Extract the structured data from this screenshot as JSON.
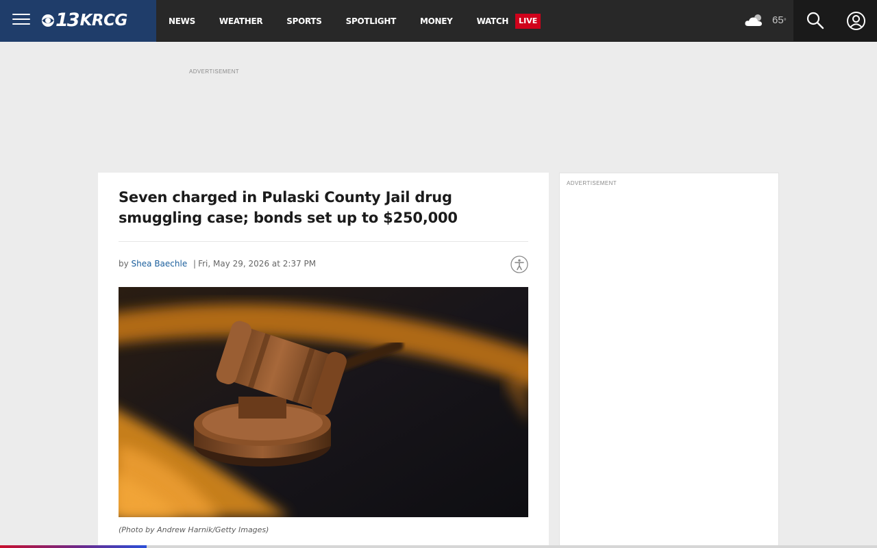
{
  "header": {
    "logo": {
      "number": "13",
      "text": "KRCG"
    },
    "nav_items": [
      {
        "label": "NEWS"
      },
      {
        "label": "WEATHER"
      },
      {
        "label": "SPORTS"
      },
      {
        "label": "SPOTLIGHT"
      },
      {
        "label": "MONEY"
      }
    ],
    "watch": {
      "label": "WATCH",
      "live_badge": "LIVE"
    },
    "weather": {
      "temperature": "65",
      "degree_symbol": "°",
      "icon": "partly-cloudy-icon"
    },
    "icons": {
      "menu": "menu-icon",
      "search": "search-icon",
      "account": "user-icon"
    }
  },
  "ads": {
    "top_label": "ADVERTISEMENT",
    "sidebar_label": "ADVERTISEMENT"
  },
  "article": {
    "headline": "Seven charged in Pulaski County Jail drug smuggling case; bonds set up to $250,000",
    "byline": {
      "prefix": "by",
      "author": "Shea Baechle",
      "separator": "|",
      "date": "Fri, May 29, 2026 at 2:37 PM"
    },
    "photo_icon": "gavel-photo",
    "caption": "(Photo by Andrew Harnik/Getty Images)"
  },
  "reading_progress": 0.167,
  "colors": {
    "header_bg": "#282828",
    "brand_bg": "#1f3d6a",
    "live_badge": "#d0021b",
    "author_link": "#1a5e9c",
    "page_bg": "#ececec"
  }
}
